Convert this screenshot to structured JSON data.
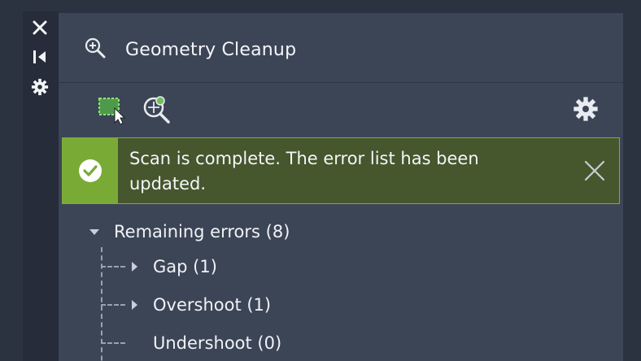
{
  "side_toolbar": {
    "close_icon": "close-icon",
    "dock_icon": "dock-icon",
    "settings_icon": "gear-icon"
  },
  "panel": {
    "title": "Geometry Cleanup",
    "title_icon": "zoom-in-icon"
  },
  "toolbar": {
    "select_tool_icon": "select-objects-icon",
    "zoom_tool_icon": "zoom-to-error-icon",
    "settings_icon": "gear-icon"
  },
  "alert": {
    "status": "success",
    "message": "Scan is complete. The error list has been updated.",
    "accent_color": "#7aaa36",
    "background_color": "#46562d"
  },
  "errors": {
    "root_label": "Remaining errors (8)",
    "root_expanded": true,
    "items": [
      {
        "label": "Gap (1)",
        "expandable": true
      },
      {
        "label": "Overshoot (1)",
        "expandable": true
      },
      {
        "label": "Undershoot (0)",
        "expandable": false
      }
    ]
  },
  "colors": {
    "background": "#2b3240",
    "panel": "#3c4556",
    "toolbar_highlight": "#6fbf5a"
  }
}
